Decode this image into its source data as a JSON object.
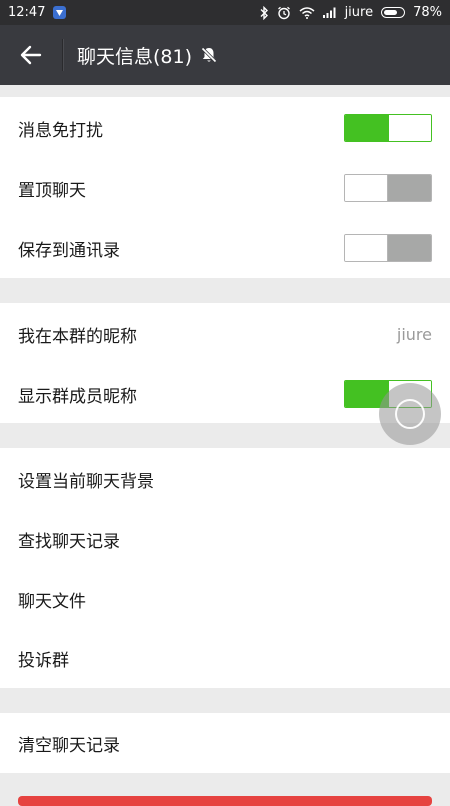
{
  "status_bar": {
    "time": "12:47",
    "carrier": "jiure",
    "battery": "78%",
    "battery_level": 0.78
  },
  "header": {
    "title": "聊天信息(81)"
  },
  "settings": {
    "mute": {
      "label": "消息免打扰",
      "enabled": true
    },
    "pin": {
      "label": "置顶聊天",
      "enabled": false
    },
    "save_contacts": {
      "label": "保存到通讯录",
      "enabled": false
    },
    "nickname": {
      "label": "我在本群的昵称",
      "value": "jiure"
    },
    "show_member_names": {
      "label": "显示群成员昵称",
      "enabled": true
    },
    "chat_background": {
      "label": "设置当前聊天背景"
    },
    "search_history": {
      "label": "查找聊天记录"
    },
    "chat_files": {
      "label": "聊天文件"
    },
    "report_group": {
      "label": "投诉群"
    },
    "clear_history": {
      "label": "清空聊天记录"
    }
  },
  "colors": {
    "toggle_on": "#44c122",
    "toggle_off": "#a7a8a7",
    "header_bg": "#393a3f",
    "danger": "#e64340"
  },
  "icons": {
    "back": "arrow-left-icon",
    "muted": "bell-off-icon",
    "floating_assist": "assistive-touch-icon"
  }
}
